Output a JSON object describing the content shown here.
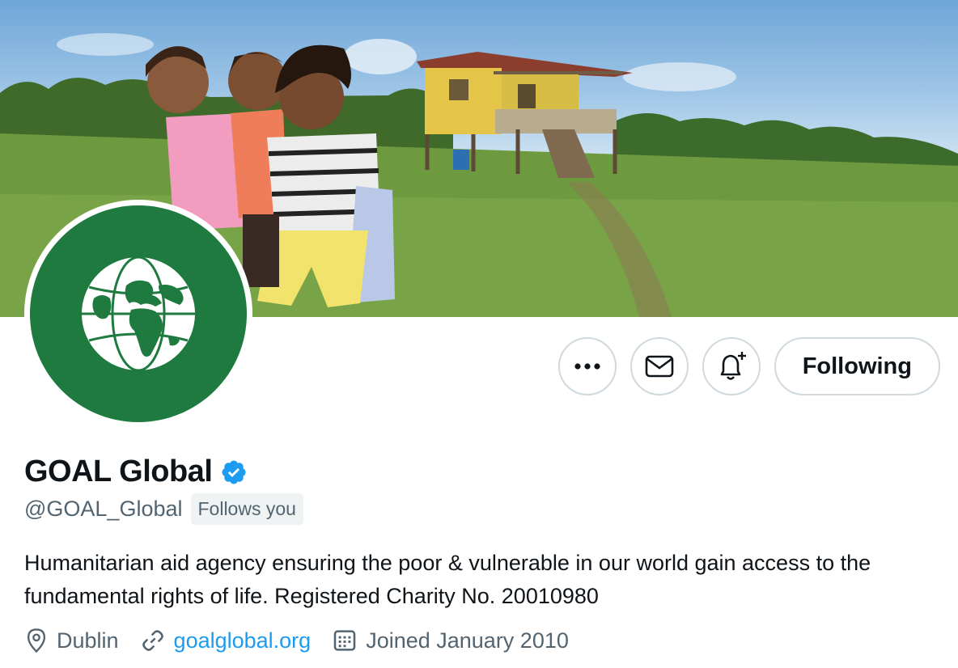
{
  "profile": {
    "display_name": "GOAL Global",
    "verified": true,
    "handle": "@GOAL_Global",
    "follows_you_label": "Follows you",
    "bio": "Humanitarian aid agency ensuring the poor & vulnerable in our world gain access to the fundamental rights of life. Registered Charity No. 20010980",
    "location": "Dublin",
    "website": "goalglobal.org",
    "joined": "Joined January 2010"
  },
  "actions": {
    "more_icon": "more-dots-icon",
    "message_icon": "envelope-icon",
    "notify_icon": "bell-plus-icon",
    "follow_label": "Following"
  },
  "icons": {
    "location": "map-pin-icon",
    "website": "link-icon",
    "joined": "calendar-icon",
    "verified": "verified-badge-icon",
    "avatar_logo": "globe-icon"
  },
  "colors": {
    "accent": "#1d9bf0",
    "avatar_bg": "#1f7a3f",
    "text_primary": "#0f1419",
    "text_secondary": "#536471",
    "border": "#cfd9de"
  }
}
